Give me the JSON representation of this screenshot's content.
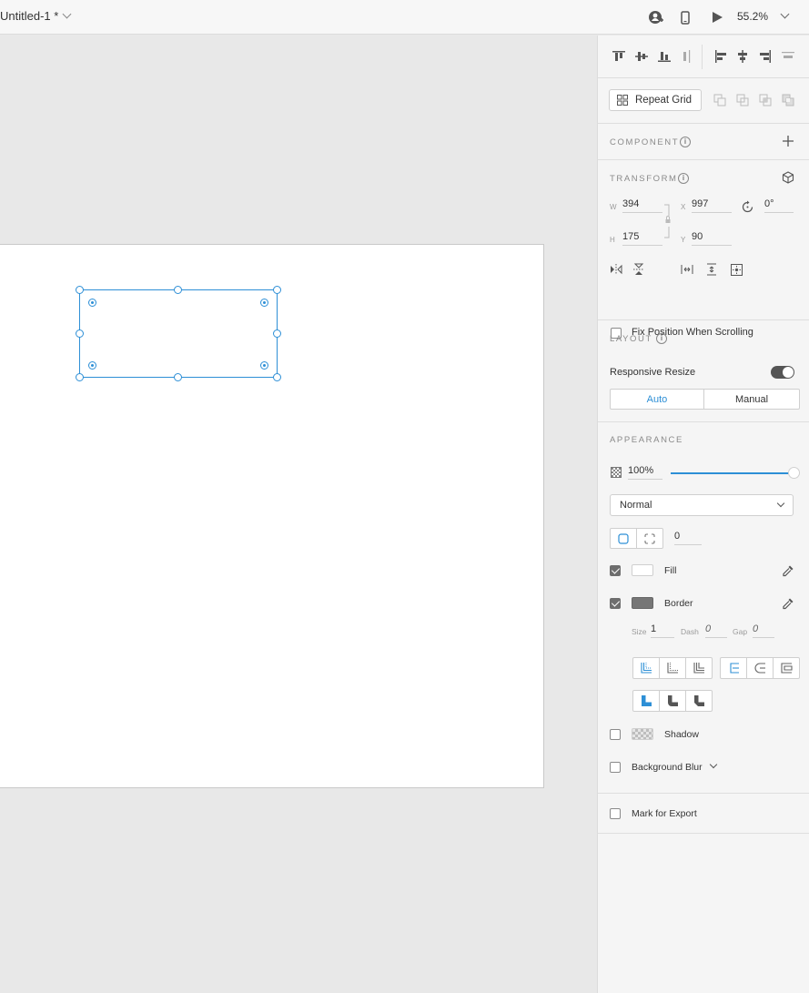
{
  "topbar": {
    "doc_title": "Untitled-1 *",
    "zoom": "55.2%"
  },
  "panel": {
    "repeat_grid_label": "Repeat Grid",
    "component_title": "COMPONENT",
    "transform": {
      "title": "TRANSFORM",
      "w_label": "W",
      "w_value": "394",
      "h_label": "H",
      "h_value": "175",
      "x_label": "X",
      "x_value": "997",
      "y_label": "Y",
      "y_value": "90",
      "rotation": "0°",
      "fix_position_label": "Fix Position When Scrolling"
    },
    "layout": {
      "title": "LAYOUT",
      "responsive_label": "Responsive Resize",
      "auto_label": "Auto",
      "manual_label": "Manual"
    },
    "appearance": {
      "title": "APPEARANCE",
      "opacity": "100%",
      "opacity_fraction": 1.0,
      "blend_mode": "Normal",
      "corner_radius": "0",
      "fill_label": "Fill",
      "border_label": "Border",
      "size_label": "Size",
      "size_value": "1",
      "dash_label": "Dash",
      "dash_value": "0",
      "gap_label": "Gap",
      "gap_value": "0",
      "shadow_label": "Shadow",
      "background_blur_label": "Background Blur"
    },
    "export_label": "Mark for Export"
  },
  "colors": {
    "accent": "#2d8fd6",
    "border_swatch": "#767676",
    "fill_swatch": "#ffffff"
  }
}
